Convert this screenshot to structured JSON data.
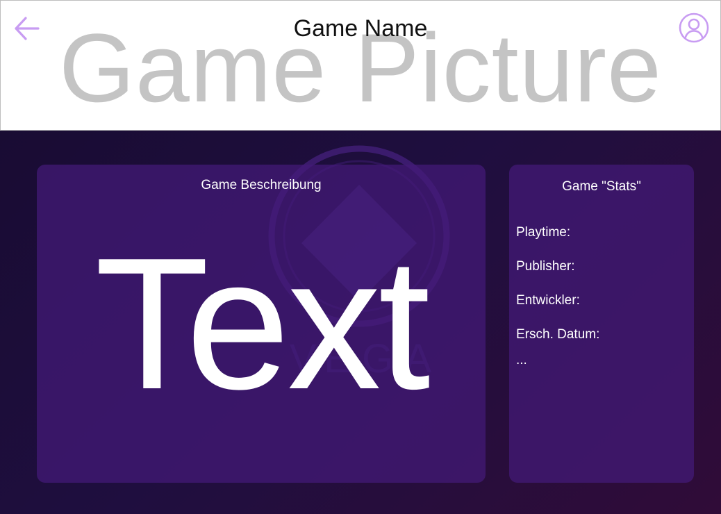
{
  "header": {
    "title": "Game Name",
    "picture_placeholder": "Game Picture",
    "back_icon": "arrow-left-icon",
    "profile_icon": "user-circle-icon"
  },
  "description": {
    "heading": "Game Beschreibung",
    "text": "Text"
  },
  "stats": {
    "heading": "Game \"Stats\"",
    "items": [
      {
        "label": "Playtime:"
      },
      {
        "label": "Publisher:"
      },
      {
        "label": "Entwickler:"
      },
      {
        "label": "Ersch. Datum:"
      }
    ],
    "more": "..."
  },
  "colors": {
    "accent": "#c89cf2",
    "header_bg": "#ffffff",
    "background_start": "#190c33",
    "background_end": "#300c38",
    "panel": "#441a78"
  }
}
